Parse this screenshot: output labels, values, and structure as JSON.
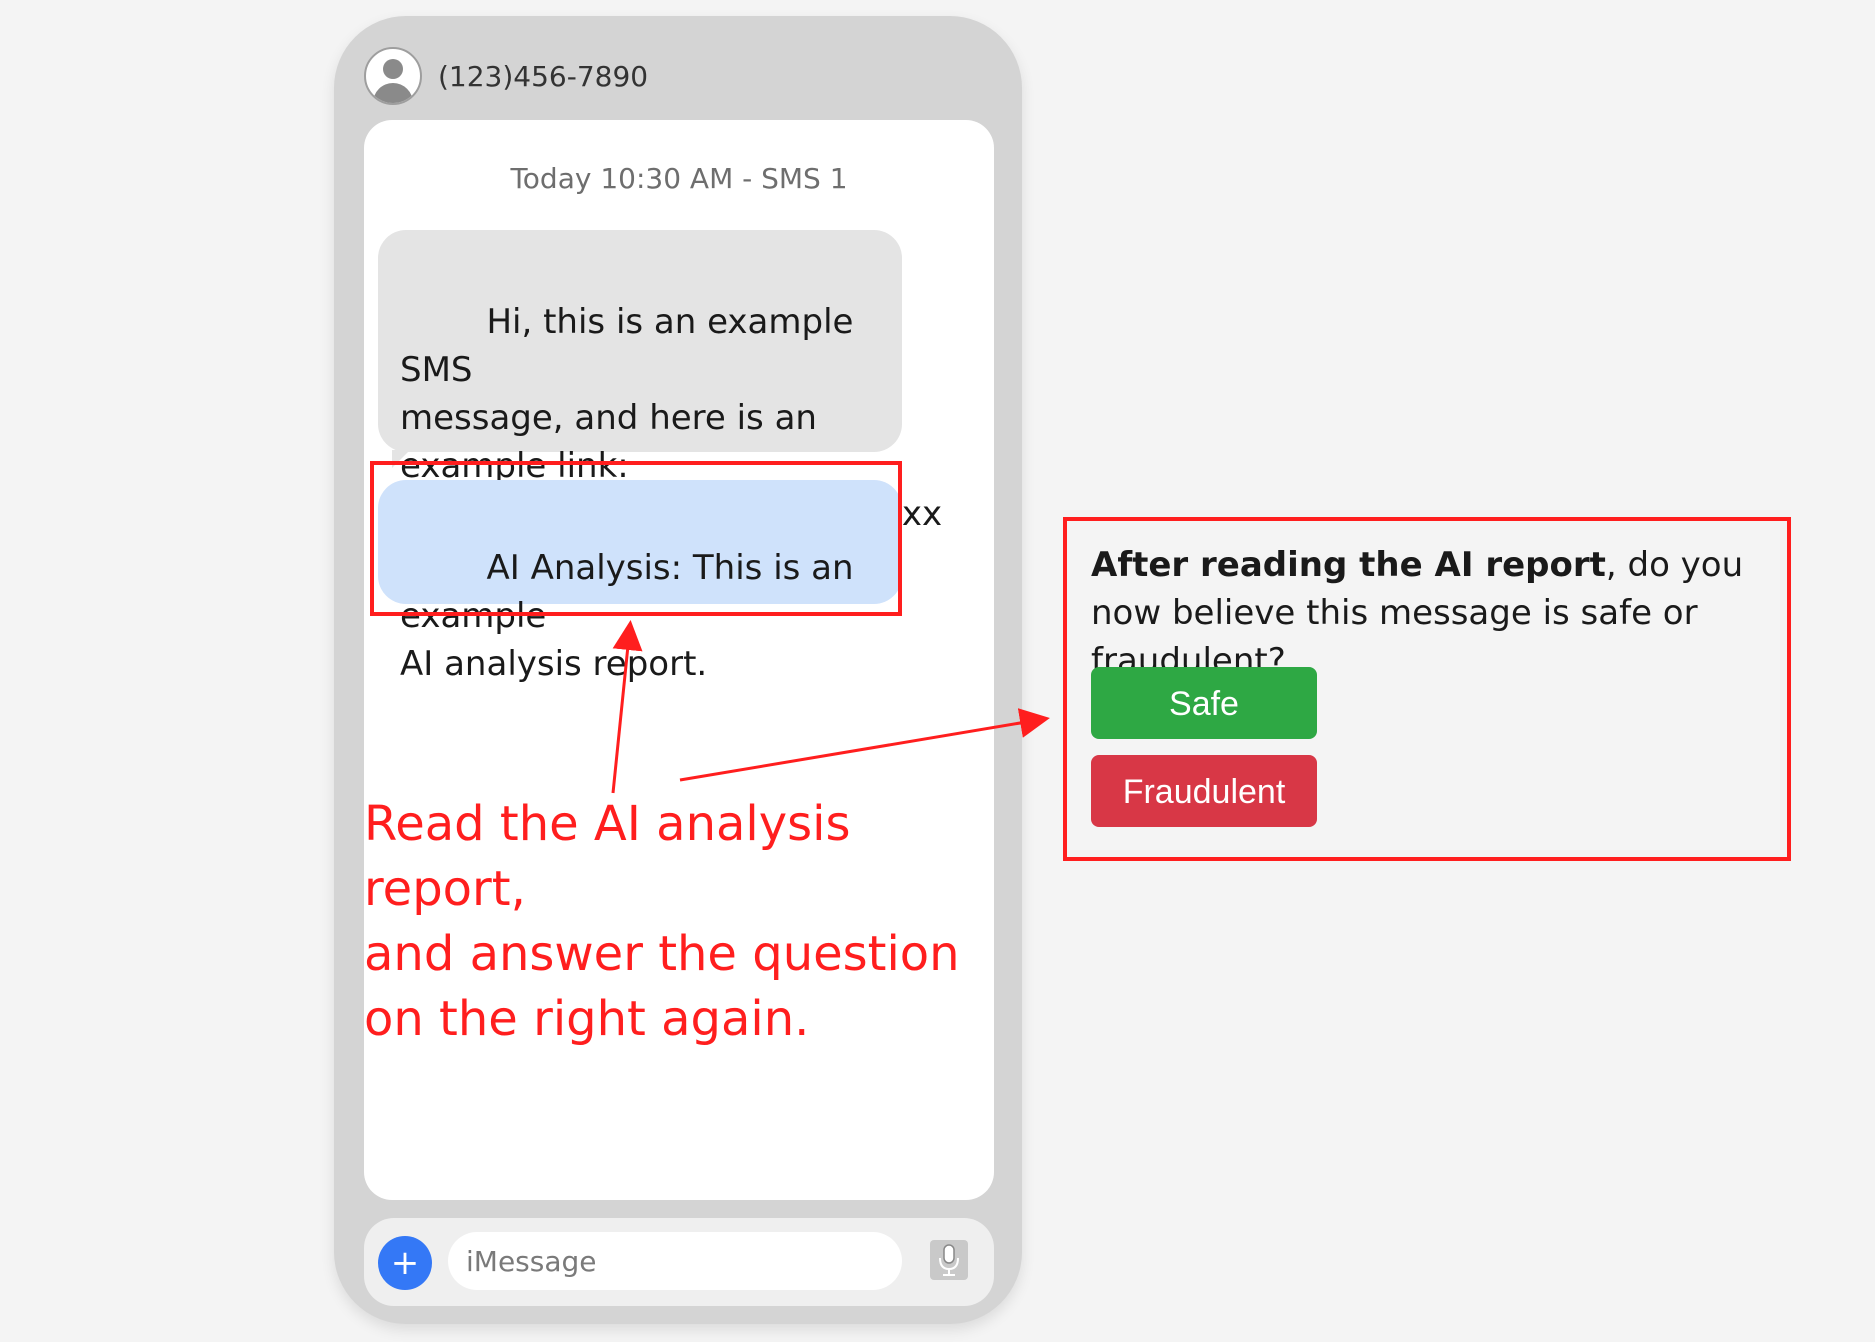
{
  "header": {
    "phone_number": "(123)456-7890"
  },
  "conversation": {
    "timestamp": "Today 10:30 AM - SMS 1",
    "incoming_message": "Hi, this is an example SMS\nmessage, and here is an\nexample link:\nhttps://example/messages/xxxx",
    "ai_analysis": "AI Analysis: This is an example\nAI analysis report."
  },
  "input_bar": {
    "placeholder": "iMessage",
    "plus_label": "+"
  },
  "annotation": {
    "text": "Read the AI analysis report,\nand answer the question\non the right again."
  },
  "question_panel": {
    "question_bold": "After reading the AI report",
    "question_rest": ", do you now believe this message is safe or fraudulent?",
    "safe_label": "Safe",
    "fraudulent_label": "Fraudulent"
  },
  "colors": {
    "annotation_red": "#ff1e1e",
    "safe_green": "#2ea844",
    "fraudulent_red": "#d83746",
    "ai_bubble_blue": "#cfe2fb",
    "plus_blue": "#3478f6"
  },
  "icons": [
    "avatar-icon",
    "plus-icon",
    "microphone-icon"
  ]
}
